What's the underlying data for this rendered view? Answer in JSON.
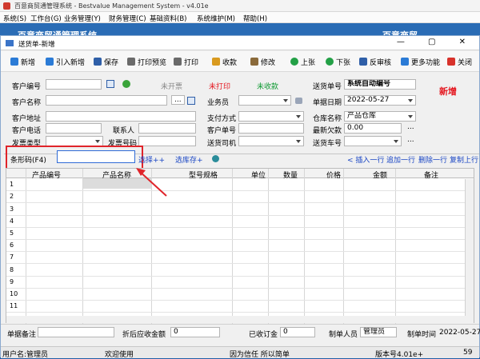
{
  "app": {
    "title": "百意商贸通管理系统 - Bestvalue Management System - v4.01e",
    "bg_title_left": "百意商贸通管理系统",
    "bg_title_right": "百意商贸"
  },
  "menu": [
    "系统(S)",
    "工作台(G)",
    "业务管理(Y)",
    "财务管理(C)",
    "基础资料(B)",
    "系统维护(M)",
    "帮助(H)"
  ],
  "dialog": {
    "title": "送货单-新增",
    "window_buttons": "— ▢ ✕"
  },
  "toolbar": {
    "new": "新增",
    "import_new": "引入新增",
    "save": "保存",
    "print_preview": "打印预览",
    "print": "打印",
    "receive": "收款",
    "modify": "修改",
    "prev": "上张",
    "next": "下张",
    "unapprove": "反审核",
    "more": "更多功能",
    "close": "关闭"
  },
  "form": {
    "customer_no_label": "客户编号",
    "not_invoiced": "未开票",
    "not_printed": "未打印",
    "not_collected": "未收款",
    "delivery_no_label": "送货单号",
    "delivery_no_value": "系统自动编号",
    "status_new": "新增",
    "customer_name_label": "客户名称",
    "salesman_label": "业务员",
    "doc_date_label": "单据日期",
    "doc_date_value": "2022-05-27",
    "customer_address_label": "客户地址",
    "payment_label": "支付方式",
    "warehouse_label": "仓库名称",
    "warehouse_value": "产品仓库",
    "customer_phone_label": "客户电话",
    "contact_label": "联系人",
    "customer_order_label": "客户单号",
    "latest_debt_label": "最新欠款",
    "latest_debt_value": "0.00",
    "invoice_type_label": "发票类型",
    "invoice_no_label": "发票号码",
    "driver_label": "送货司机",
    "vehicle_label": "送货车号",
    "ellipsis": "..."
  },
  "barcode": {
    "label": "条形码(F4)",
    "value": "",
    "select_link": "选择++",
    "stock_link": "选库存+",
    "insert_row": "< 插入一行",
    "add_row": "追加一行",
    "delete_row": "删除一行",
    "copy_prev": "复制上行"
  },
  "grid": {
    "columns": [
      "产品编号",
      "产品名称",
      "型号规格",
      "单位",
      "数量",
      "价格",
      "金额",
      "备注"
    ],
    "row_numbers": [
      "1",
      "2",
      "3",
      "4",
      "5",
      "6",
      "7",
      "8",
      "9",
      "10",
      "11"
    ]
  },
  "footer": {
    "memo_label": "单据备注",
    "discount_label": "折后应收金额",
    "discount_value": "0",
    "received_label": "已收订金",
    "received_value": "0",
    "maker_label": "制单人员",
    "maker_value": "管理员",
    "make_time_label": "制单时间",
    "make_time_value": "2022-05-27"
  },
  "status": {
    "user": "用户名:管理员",
    "welcome": "欢迎使用",
    "slogan": "因为信任 所以简单",
    "version": "版本号4.01e+",
    "extra": "59"
  },
  "colors": {
    "highlight": "#e0242a",
    "link": "#1a46c4",
    "red_text": "#e4141d",
    "green_text": "#0f9a33"
  }
}
